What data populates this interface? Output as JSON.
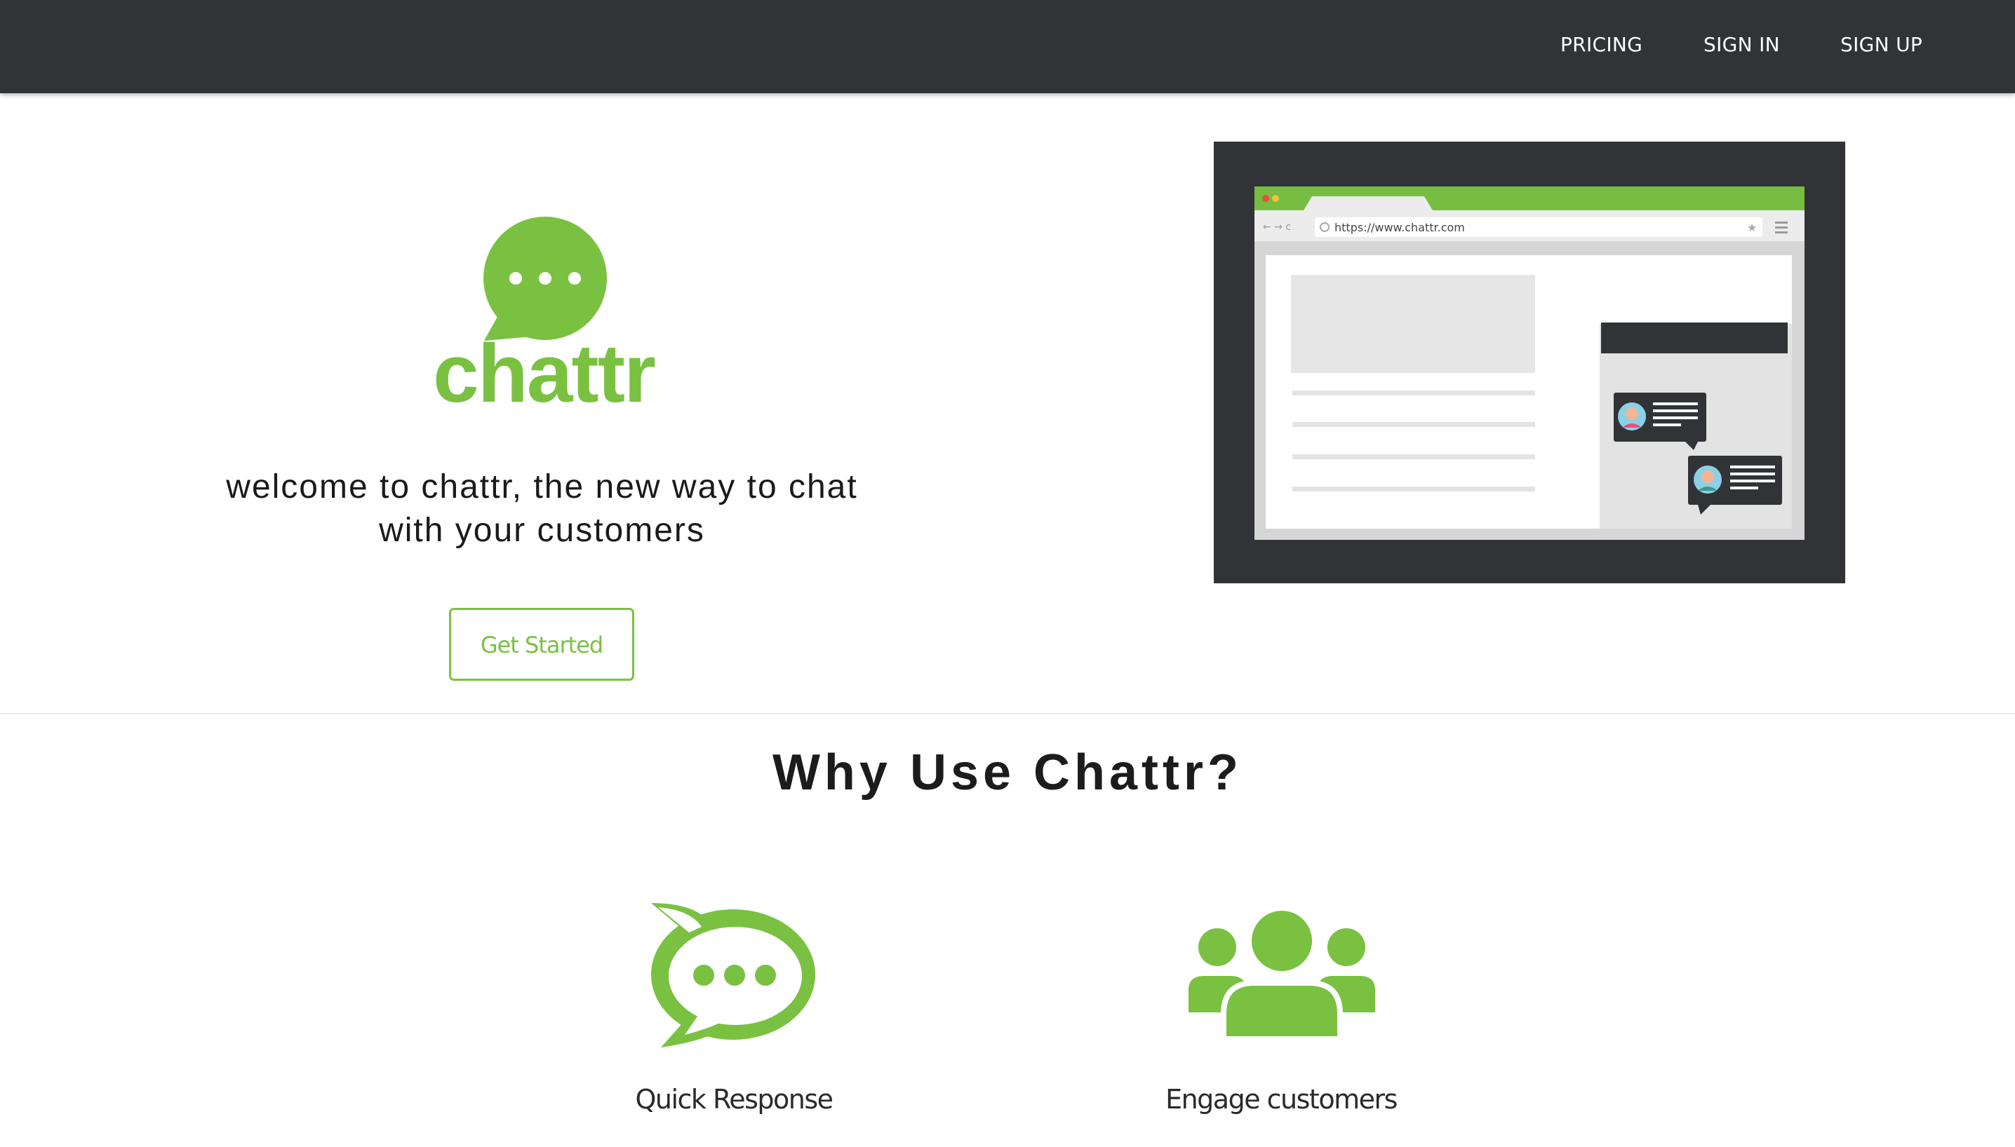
{
  "nav": {
    "pricing": "PRICING",
    "sign_in": "SIGN IN",
    "sign_up": "SIGN UP"
  },
  "hero": {
    "brand": "chattr",
    "tagline_line1": "welcome to chattr, the new way to chat",
    "tagline_line2": "with your customers",
    "cta_label": "Get Started"
  },
  "mockup": {
    "url": "https://www.chattr.com"
  },
  "why": {
    "title": "Why Use Chattr?",
    "features": [
      {
        "label": "Quick Response",
        "icon": "chat-bubble-icon"
      },
      {
        "label": "Engage customers",
        "icon": "users-group-icon"
      }
    ]
  },
  "colors": {
    "brand_green": "#7ac142",
    "navbar": "#323336",
    "dark_frame": "#323336"
  }
}
